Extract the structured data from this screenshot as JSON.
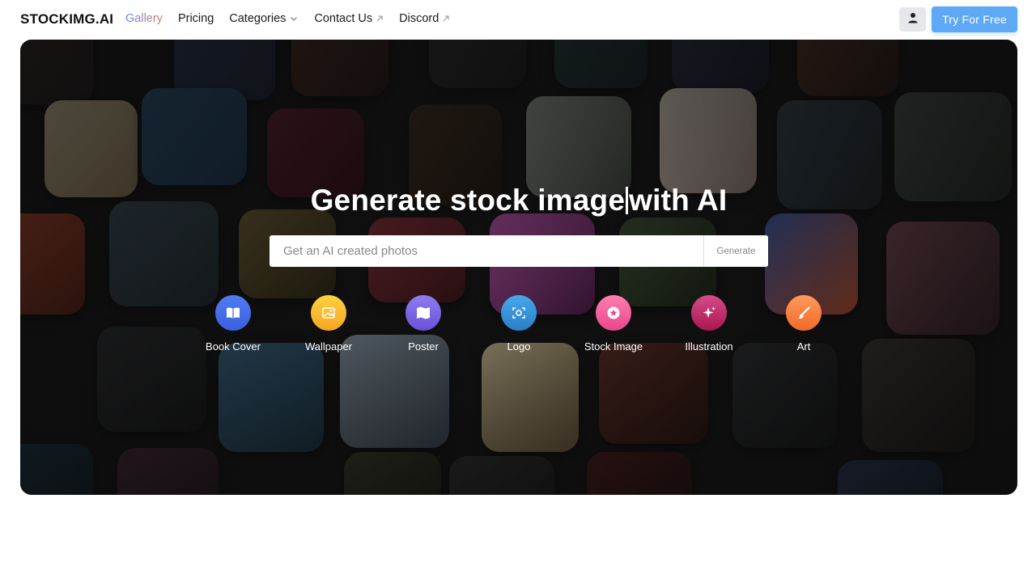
{
  "header": {
    "logo": "STOCKIMG.AI",
    "nav": [
      {
        "label": "Gallery",
        "icon": null
      },
      {
        "label": "Pricing",
        "icon": null
      },
      {
        "label": "Categories",
        "icon": "chevron-down-icon"
      },
      {
        "label": "Contact Us",
        "icon": "external-link-icon"
      },
      {
        "label": "Discord",
        "icon": "external-link-icon"
      }
    ],
    "user_icon": "user-icon",
    "cta_label": "Try For Free"
  },
  "hero": {
    "headline_before_caret": "Generate stock image",
    "headline_after_caret": "with AI",
    "search": {
      "placeholder": "Get an AI created photos",
      "value": ""
    },
    "generate_label": "Generate",
    "categories": [
      {
        "label": "Book Cover",
        "icon": "book-icon",
        "color_from": "#4f7df0",
        "color_to": "#3b5fe0"
      },
      {
        "label": "Wallpaper",
        "icon": "image-icon",
        "color_from": "#ffd23f",
        "color_to": "#f5a623"
      },
      {
        "label": "Poster",
        "icon": "map-icon",
        "color_from": "#8e7cf0",
        "color_to": "#6a52d6"
      },
      {
        "label": "Logo",
        "icon": "focus-icon",
        "color_from": "#46a8e8",
        "color_to": "#2a7fc8"
      },
      {
        "label": "Stock Image",
        "icon": "star-icon",
        "color_from": "#ff7fb0",
        "color_to": "#e8478a"
      },
      {
        "label": "Illustration",
        "icon": "sparkles-icon",
        "color_from": "#d64b8a",
        "color_to": "#a8184e"
      },
      {
        "label": "Art",
        "icon": "brush-icon",
        "color_from": "#ff9a5a",
        "color_to": "#f06a2a"
      }
    ]
  },
  "colors": {
    "cta": "#5ea9f5",
    "gallery_gradient": [
      "#5b8def",
      "#d07a6a"
    ]
  }
}
